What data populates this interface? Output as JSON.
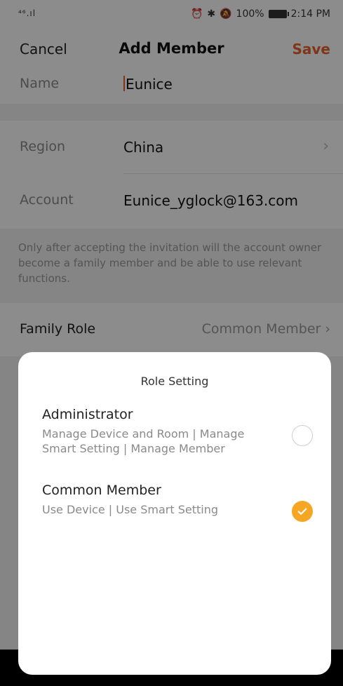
{
  "status_bar": {
    "signal": "⁴⁶.ıl",
    "battery_pct": "100%",
    "time": "2:14 PM"
  },
  "nav": {
    "cancel": "Cancel",
    "title": "Add Member",
    "save": "Save"
  },
  "form": {
    "name_label": "Name",
    "name_value": "Eunice",
    "region_label": "Region",
    "region_value": "China",
    "account_label": "Account",
    "account_value": "Eunice_yglock@163.com",
    "note": "Only after accepting the invitation will the account owner become a family member and be able to use relevant functions.",
    "role_label": "Family Role",
    "role_value": "Common Member"
  },
  "sheet": {
    "title": "Role Setting",
    "options": [
      {
        "title": "Administrator",
        "desc": "Manage Device and Room | Manage Smart Setting | Manage Member",
        "selected": false
      },
      {
        "title": "Common Member",
        "desc": "Use Device | Use Smart Setting",
        "selected": true
      }
    ]
  },
  "colors": {
    "accent": "#e8622a",
    "selected": "#f5a623"
  }
}
